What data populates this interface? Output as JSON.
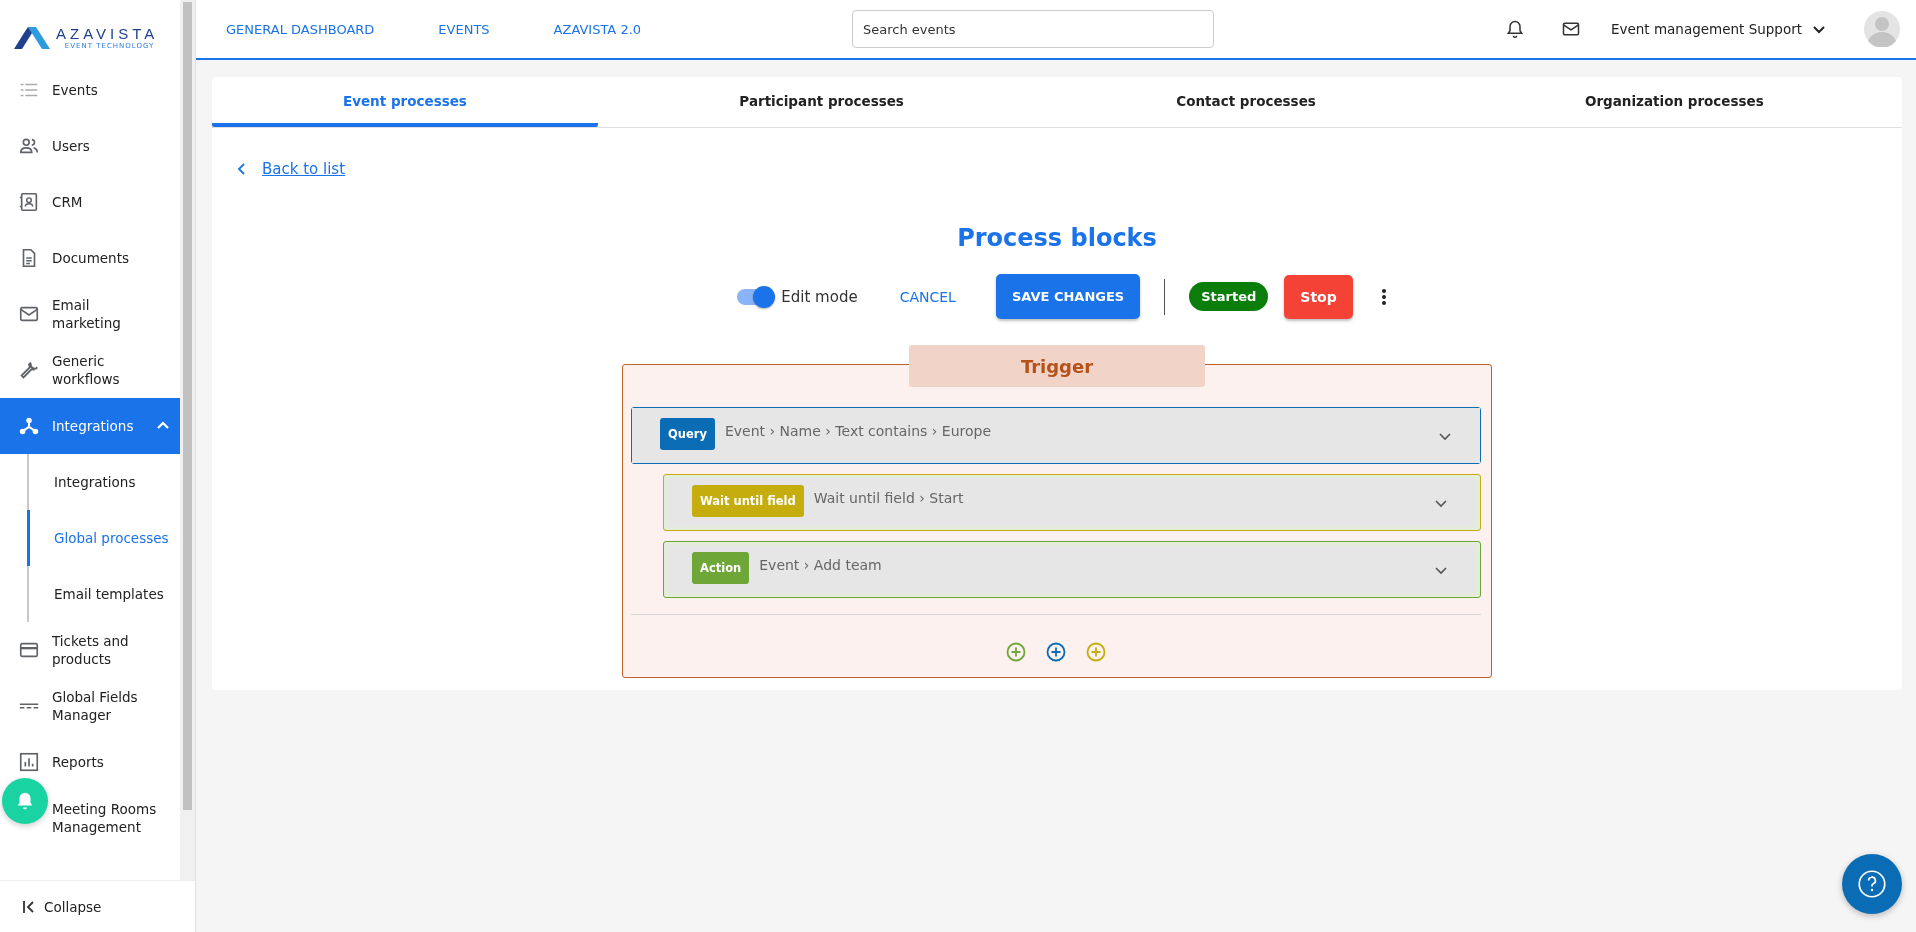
{
  "logo": {
    "name": "AZAVISTA",
    "tagline": "EVENT TECHNOLOGY"
  },
  "sidebar": {
    "items": [
      {
        "label": "Events",
        "selected": false
      },
      {
        "label": "Users",
        "selected": false
      },
      {
        "label": "CRM",
        "selected": false
      },
      {
        "label": "Documents",
        "selected": false
      },
      {
        "label": "Email marketing",
        "selected": false
      },
      {
        "label": "Generic workflows",
        "selected": false
      },
      {
        "label": "Integrations",
        "selected": true,
        "expanded": true,
        "children": [
          {
            "label": "Integrations",
            "selected": false
          },
          {
            "label": "Global processes",
            "selected": true
          },
          {
            "label": "Email templates",
            "selected": false
          }
        ]
      },
      {
        "label": "Tickets and products",
        "selected": false
      },
      {
        "label": "Global Fields Manager",
        "selected": false
      },
      {
        "label": "Reports",
        "selected": false
      },
      {
        "label": "Meeting Rooms Management",
        "selected": false
      }
    ],
    "collapse": "Collapse"
  },
  "topbar": {
    "links": [
      "GENERAL DASHBOARD",
      "EVENTS",
      "AZAVISTA 2.0"
    ],
    "search": {
      "placeholder": "Search events"
    },
    "user": "Event management Support"
  },
  "tabs": [
    {
      "label": "Event processes",
      "selected": true
    },
    {
      "label": "Participant processes",
      "selected": false
    },
    {
      "label": "Contact processes",
      "selected": false
    },
    {
      "label": "Organization processes",
      "selected": false
    }
  ],
  "back_link": "Back to list",
  "title": "Process blocks",
  "toolbar": {
    "edit_mode": {
      "label": "Edit mode",
      "on": true
    },
    "cancel": "CANCEL",
    "save": "SAVE CHANGES",
    "status": "Started",
    "stop": "Stop"
  },
  "trigger": {
    "title": "Trigger",
    "blocks": [
      {
        "badge": "Query",
        "color": "#0a6cb4",
        "text": "Event › Name › Text contains › Europe",
        "children": [
          {
            "badge": "Wait until field",
            "color": "#c4ad0c",
            "text": "Wait until field › Start"
          },
          {
            "badge": "Action",
            "color": "#6ea738",
            "text": "Event › Add team"
          }
        ]
      }
    ],
    "add_buttons": [
      {
        "color": "#6ea738"
      },
      {
        "color": "#0a6cb4"
      },
      {
        "color": "#c4ad0c"
      }
    ]
  }
}
